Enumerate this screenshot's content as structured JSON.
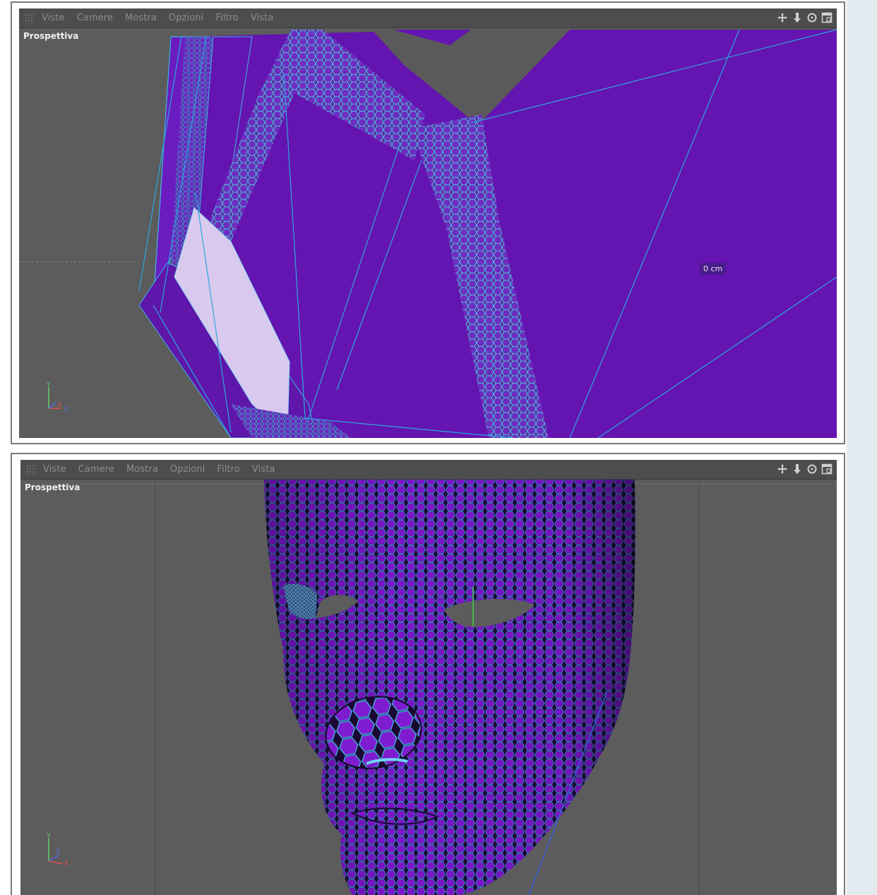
{
  "panels": [
    {
      "menu": [
        "Viste",
        "Camere",
        "Mostra",
        "Opzioni",
        "Filtro",
        "Vista"
      ],
      "view_label": "Prospettiva",
      "hud_value": "0 cm",
      "axes": {
        "y": "Y",
        "x": "X",
        "z": "Z"
      }
    },
    {
      "menu": [
        "Viste",
        "Camere",
        "Mostra",
        "Opzioni",
        "Filtro",
        "Vista"
      ],
      "view_label": "Prospettiva",
      "axes": {
        "y": "Y",
        "z": "Z",
        "x": "X"
      }
    }
  ],
  "icons": [
    "move-icon",
    "zoom-icon",
    "rotate-icon",
    "maximize-icon"
  ],
  "colors": {
    "mesh_fill": "#6414b0",
    "wire_edge": "#39b4e6",
    "viewport_bg": "#5c5c5c",
    "menubar_bg": "#4d4d4d",
    "selection_face": "#d8c8ec"
  }
}
